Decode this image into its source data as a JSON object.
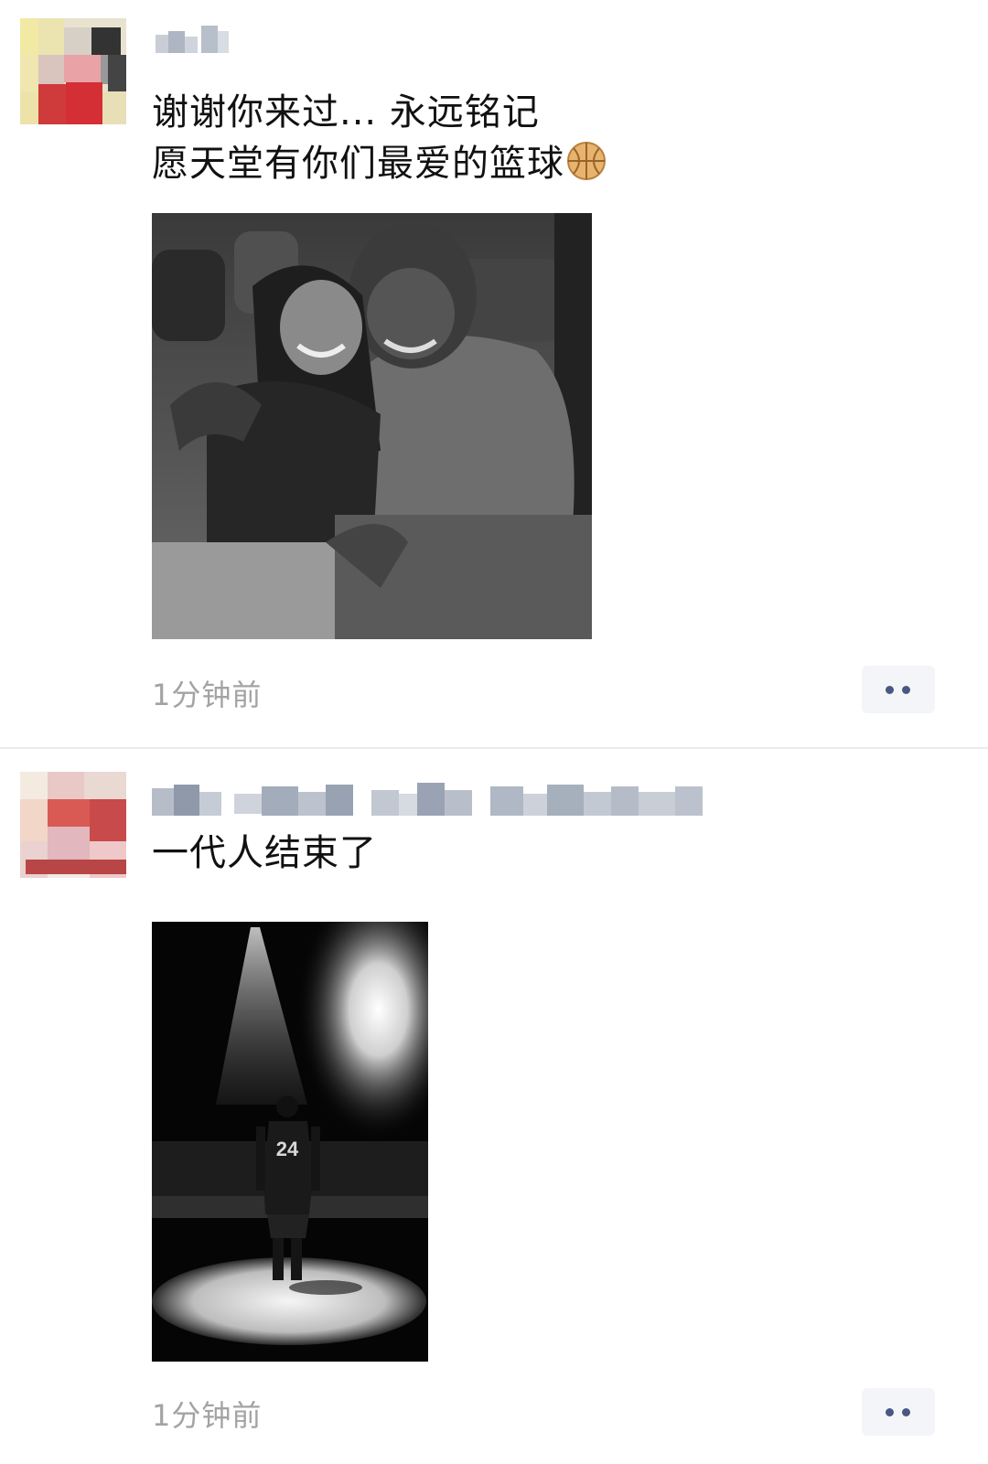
{
  "posts": [
    {
      "content_lines": [
        "谢谢你来过... 永远铭记",
        "愿天堂有你们最爱的篮球"
      ],
      "emoji": "basketball",
      "timestamp": "1分钟前"
    },
    {
      "content_lines": [
        "一代人结束了"
      ],
      "photo_text": "24",
      "timestamp": "1分钟前"
    }
  ],
  "icons": {
    "more": "more-options-icon",
    "basketball": "basketball-icon"
  },
  "colors": {
    "link_dot": "#4a5784",
    "timestamp": "#a3a3a3",
    "text": "#111111",
    "divider": "#ececec"
  }
}
